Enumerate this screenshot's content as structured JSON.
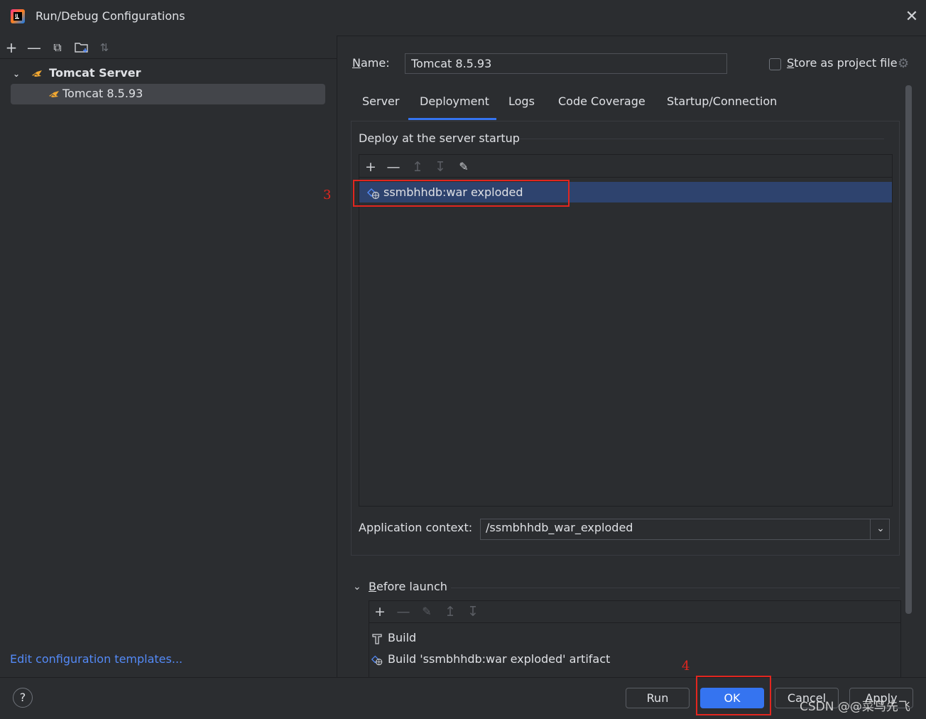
{
  "window": {
    "title": "Run/Debug Configurations"
  },
  "tree": {
    "group_label": "Tomcat Server",
    "item_label": "Tomcat 8.5.93"
  },
  "left_footer": {
    "edit_templates_link": "Edit configuration templates..."
  },
  "config": {
    "name_label_prefix": "",
    "name_label_mnemonic": "N",
    "name_label_rest": "ame:",
    "name_value": "Tomcat 8.5.93",
    "store_mnemonic": "S",
    "store_rest": "tore as project file",
    "store_checked": false
  },
  "tabs": [
    {
      "label": "Server"
    },
    {
      "label": "Deployment",
      "active": true
    },
    {
      "label": "Logs"
    },
    {
      "label": "Code Coverage"
    },
    {
      "label": "Startup/Connection"
    }
  ],
  "deployment": {
    "section_title": "Deploy at the server startup",
    "artifacts": [
      "ssmbhhdb:war exploded"
    ],
    "context_label": "Application context:",
    "context_value": "/ssmbhhdb_war_exploded"
  },
  "before_launch": {
    "title_mnemonic": "B",
    "title_rest": "efore launch",
    "tasks": [
      "Build",
      "Build 'ssmbhhdb:war exploded' artifact"
    ]
  },
  "buttons": {
    "help": "?",
    "run": "Run",
    "ok": "OK",
    "cancel": "Cancel",
    "apply": "Apply"
  },
  "annotations": {
    "step3": "3",
    "step4": "4"
  },
  "watermark": "CSDN @@菜鸟先飞",
  "colors": {
    "accent": "#3574f0",
    "selection": "#2e436e",
    "annotation_red": "#e2261f",
    "link": "#548af7"
  }
}
